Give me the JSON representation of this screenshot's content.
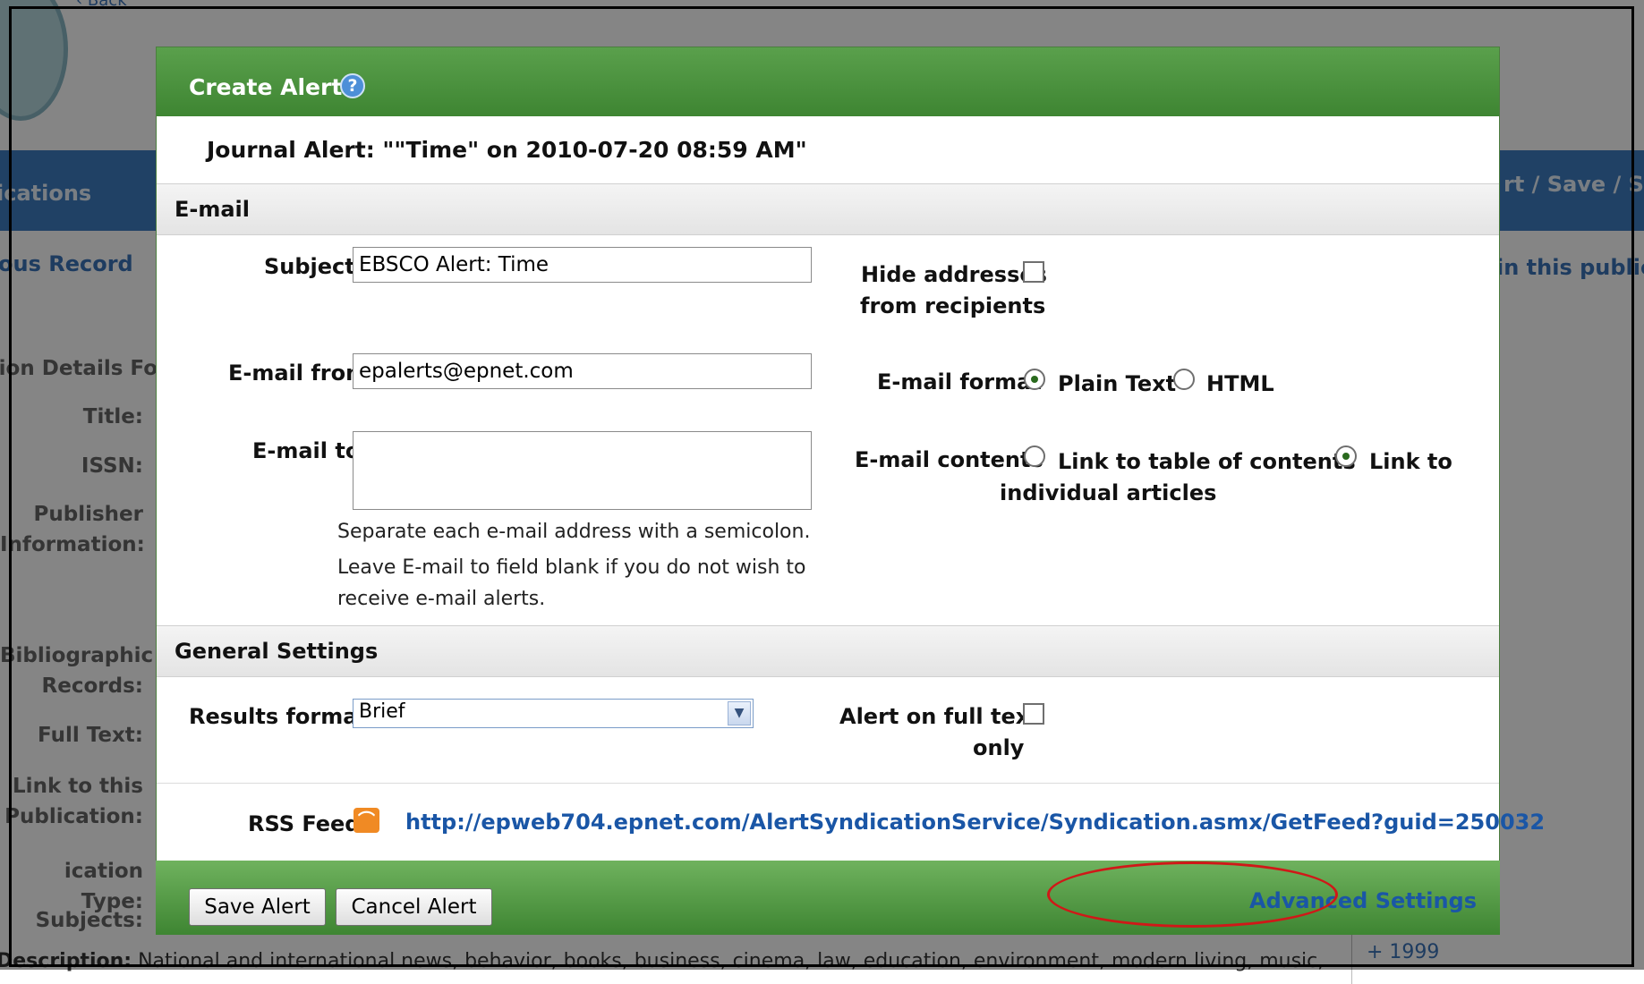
{
  "background": {
    "back_link": "‹ Back",
    "band_left_text": "ications",
    "band_right_text": "rt / Save / Sh",
    "prev_record": "ous Record",
    "in_this_pub": "in this publica",
    "details_heading": "ion Details Fo",
    "labels": [
      "Title:",
      "ISSN:",
      "Publisher Information:",
      "Bibliographic Records:",
      "Full Text:",
      "Link to this Publication:",
      "ication Type:",
      "Subjects:"
    ],
    "description_label": "Description:",
    "description_text": "National and international news, behavior, books, business, cinema, law, education, environment, modern living, music,",
    "year_text": "+ 1999"
  },
  "dialog": {
    "title": "Create Alert",
    "help_icon": "?",
    "alert_name": "Journal Alert: \"\"Time\" on 2010-07-20 08:59 AM\"",
    "email_section": {
      "heading": "E-mail",
      "subject_label": "Subject",
      "subject_value": "EBSCO Alert: Time",
      "from_label": "E-mail from",
      "from_value": "epalerts@epnet.com",
      "to_label": "E-mail to",
      "to_value": "",
      "note_line1": "Separate each e-mail address with a semicolon.",
      "note_line2": "Leave E-mail to field blank if you do not wish to receive e-mail alerts.",
      "hide_label_1": "Hide addresses",
      "hide_label_2": "from recipients",
      "hide_checked": false,
      "format_label": "E-mail format",
      "format_plain": "Plain Text",
      "format_html": "HTML",
      "format_selected": "Plain Text",
      "contents_label": "E-mail contents",
      "contents_toc": "Link to table of contents",
      "contents_articles_1": "Link to",
      "contents_articles_2": "individual articles",
      "contents_selected": "Link to individual articles"
    },
    "general_section": {
      "heading": "General Settings",
      "results_label": "Results format",
      "results_value": "Brief",
      "fulltext_label_1": "Alert on full text",
      "fulltext_label_2": "only",
      "fulltext_checked": false
    },
    "rss": {
      "label": "RSS Feed",
      "url": "http://epweb704.epnet.com/AlertSyndicationService/Syndication.asmx/GetFeed?guid=250032"
    },
    "footer": {
      "save_label": "Save Alert",
      "cancel_label": "Cancel Alert",
      "advanced_label": "Advanced Settings"
    }
  },
  "colors": {
    "header_green": "#3e8532",
    "link_blue": "#1a56a6",
    "highlight_red": "#d01818"
  }
}
